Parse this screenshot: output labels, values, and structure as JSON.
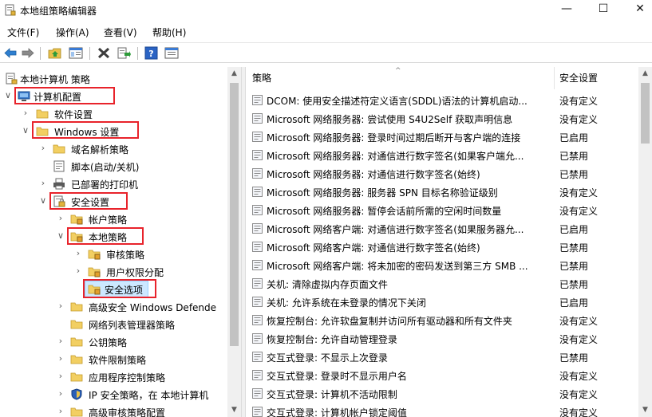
{
  "window": {
    "title": "本地组策略编辑器",
    "controls": {
      "minimize": "—",
      "maximize": "☐",
      "close": "✕"
    }
  },
  "menu": [
    {
      "label": "文件(F)"
    },
    {
      "label": "操作(A)"
    },
    {
      "label": "查看(V)"
    },
    {
      "label": "帮助(H)"
    }
  ],
  "toolbar": {
    "icons": [
      "back-arrow-icon",
      "forward-arrow-icon",
      "up-folder-icon",
      "show-hide-tree-icon",
      "delete-icon",
      "export-list-icon",
      "help-icon",
      "properties-icon"
    ]
  },
  "tree": {
    "items": [
      {
        "label": "本地计算机 策略",
        "icon": "computer-policy-icon",
        "chevron": ""
      },
      {
        "label": "计算机配置",
        "icon": "computer-icon",
        "chevron": "expanded"
      },
      {
        "label": "软件设置",
        "icon": "folder-icon",
        "chevron": "collapsed"
      },
      {
        "label": "Windows 设置",
        "icon": "folder-icon",
        "chevron": "expanded"
      },
      {
        "label": "域名解析策略",
        "icon": "folder-icon",
        "chevron": "collapsed"
      },
      {
        "label": "脚本(启动/关机)",
        "icon": "script-icon",
        "chevron": ""
      },
      {
        "label": "已部署的打印机",
        "icon": "printer-icon",
        "chevron": "collapsed"
      },
      {
        "label": "安全设置",
        "icon": "security-settings-icon",
        "chevron": "expanded"
      },
      {
        "label": "帐户策略",
        "icon": "security-folder-icon",
        "chevron": "collapsed"
      },
      {
        "label": "本地策略",
        "icon": "security-folder-icon",
        "chevron": "expanded"
      },
      {
        "label": "审核策略",
        "icon": "security-folder-icon",
        "chevron": "collapsed"
      },
      {
        "label": "用户权限分配",
        "icon": "security-folder-icon",
        "chevron": "collapsed"
      },
      {
        "label": "安全选项",
        "icon": "security-folder-icon",
        "chevron": "",
        "selected": true
      },
      {
        "label": "高级安全 Windows Defende",
        "icon": "folder-icon",
        "chevron": "collapsed"
      },
      {
        "label": "网络列表管理器策略",
        "icon": "folder-icon",
        "chevron": ""
      },
      {
        "label": "公钥策略",
        "icon": "folder-icon",
        "chevron": "collapsed"
      },
      {
        "label": "软件限制策略",
        "icon": "folder-icon",
        "chevron": "collapsed"
      },
      {
        "label": "应用程序控制策略",
        "icon": "folder-icon",
        "chevron": "collapsed"
      },
      {
        "label": "IP 安全策略，在 本地计算机",
        "icon": "ip-security-icon",
        "chevron": "collapsed"
      },
      {
        "label": "高级审核策略配置",
        "icon": "folder-icon",
        "chevron": "collapsed"
      }
    ]
  },
  "table": {
    "columns": {
      "policy": "策略",
      "setting": "安全设置"
    },
    "rows": [
      {
        "policy": "DCOM: 使用安全描述符定义语言(SDDL)语法的计算机启动...",
        "setting": "没有定义"
      },
      {
        "policy": "Microsoft 网络服务器: 尝试使用 S4U2Self 获取声明信息",
        "setting": "没有定义"
      },
      {
        "policy": "Microsoft 网络服务器: 登录时间过期后断开与客户端的连接",
        "setting": "已启用"
      },
      {
        "policy": "Microsoft 网络服务器: 对通信进行数字签名(如果客户端允...",
        "setting": "已禁用"
      },
      {
        "policy": "Microsoft 网络服务器: 对通信进行数字签名(始终)",
        "setting": "已禁用"
      },
      {
        "policy": "Microsoft 网络服务器: 服务器 SPN 目标名称验证级别",
        "setting": "没有定义"
      },
      {
        "policy": "Microsoft 网络服务器: 暂停会话前所需的空闲时间数量",
        "setting": "没有定义"
      },
      {
        "policy": "Microsoft 网络客户端: 对通信进行数字签名(如果服务器允...",
        "setting": "已启用"
      },
      {
        "policy": "Microsoft 网络客户端: 对通信进行数字签名(始终)",
        "setting": "已禁用"
      },
      {
        "policy": "Microsoft 网络客户端: 将未加密的密码发送到第三方 SMB ...",
        "setting": "已禁用"
      },
      {
        "policy": "关机: 清除虚拟内存页面文件",
        "setting": "已禁用"
      },
      {
        "policy": "关机: 允许系统在未登录的情况下关闭",
        "setting": "已启用"
      },
      {
        "policy": "恢复控制台: 允许软盘复制并访问所有驱动器和所有文件夹",
        "setting": "没有定义"
      },
      {
        "policy": "恢复控制台: 允许自动管理登录",
        "setting": "没有定义"
      },
      {
        "policy": "交互式登录: 不显示上次登录",
        "setting": "已禁用"
      },
      {
        "policy": "交互式登录: 登录时不显示用户名",
        "setting": "没有定义"
      },
      {
        "policy": "交互式登录: 计算机不活动限制",
        "setting": "没有定义"
      },
      {
        "policy": "交互式登录: 计算机帐户锁定阈值",
        "setting": "没有定义"
      }
    ]
  },
  "highlight_color": "#e8232b",
  "selection_color": "#cce8ff"
}
